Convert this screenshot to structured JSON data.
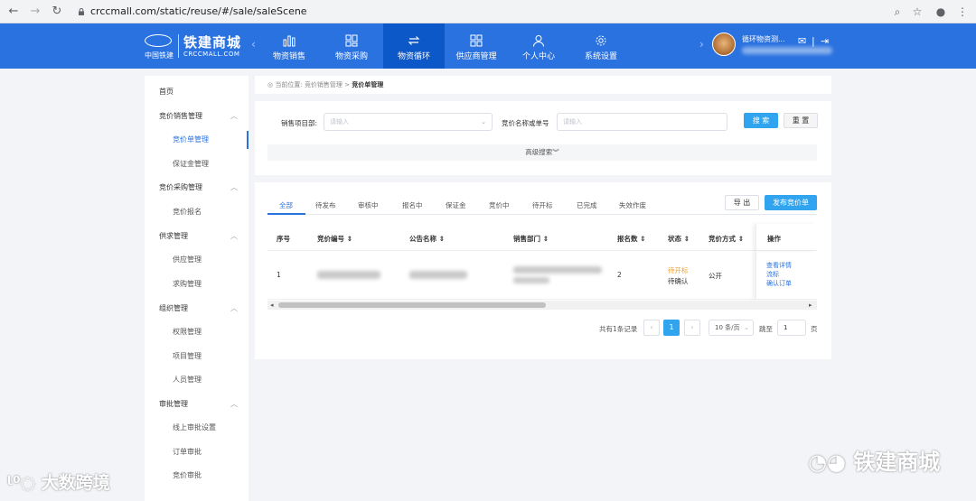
{
  "browser": {
    "url": "crccmall.com/static/reuse/#/sale/saleScene"
  },
  "header": {
    "brand": "铁建商城",
    "brand_sub": "CRCCMALL.COM",
    "org": "中国铁建",
    "nav": [
      {
        "label": "物资销售",
        "icon": "bar-chart-icon"
      },
      {
        "label": "物资采购",
        "icon": "grid-icon"
      },
      {
        "label": "物资循环",
        "icon": "recycle-icon"
      },
      {
        "label": "供应商管理",
        "icon": "apps-icon"
      },
      {
        "label": "个人中心",
        "icon": "user-icon"
      },
      {
        "label": "系统设置",
        "icon": "gear-icon"
      }
    ],
    "active_nav": "物资循环",
    "user_name": "循环物资测..."
  },
  "sidebar": {
    "items": [
      {
        "label": "首页",
        "level": "top"
      },
      {
        "label": "竞价销售管理",
        "level": "top"
      },
      {
        "label": "竞价单管理",
        "level": "sub"
      },
      {
        "label": "保证金管理",
        "level": "sub"
      },
      {
        "label": "竞价采购管理",
        "level": "top"
      },
      {
        "label": "竞价报名",
        "level": "sub"
      },
      {
        "label": "供求管理",
        "level": "top"
      },
      {
        "label": "供应管理",
        "level": "sub"
      },
      {
        "label": "求购管理",
        "level": "sub"
      },
      {
        "label": "组织管理",
        "level": "top"
      },
      {
        "label": "权限管理",
        "level": "sub"
      },
      {
        "label": "项目管理",
        "level": "sub"
      },
      {
        "label": "人员管理",
        "level": "sub"
      },
      {
        "label": "审批管理",
        "level": "top"
      },
      {
        "label": "线上审批设置",
        "level": "sub"
      },
      {
        "label": "订单审批",
        "level": "sub"
      },
      {
        "label": "竞价审批",
        "level": "sub"
      }
    ]
  },
  "breadcrumb": {
    "prefix": "当前位置:",
    "parent": "竞价销售管理",
    "sep": ">",
    "current": "竞价单管理"
  },
  "search": {
    "project_label": "销售项目部:",
    "project_placeholder": "请输入",
    "name_label": "竞价名称或单号",
    "name_placeholder": "请输入",
    "search_btn": "搜 索",
    "reset_btn": "重 置",
    "advanced": "高级搜索"
  },
  "tabs": [
    "全部",
    "待发布",
    "审核中",
    "报名中",
    "保证金",
    "竞价中",
    "待开标",
    "已完成",
    "失效作废"
  ],
  "actions": {
    "export": "导 出",
    "publish": "发布竞价单"
  },
  "table": {
    "columns": [
      "序号",
      "竞价编号",
      "公告名称",
      "销售部门",
      "报名数",
      "状态",
      "竞价方式",
      "操作"
    ],
    "row": {
      "index": "1",
      "count": "2",
      "status1": "待开标",
      "status2": "待确认",
      "method": "公开",
      "ops": [
        "查看详情",
        "流标",
        "确认订单"
      ]
    }
  },
  "pagination": {
    "total": "共有1条记录",
    "current": "1",
    "page_size": "10 条/页",
    "goto": "跳至",
    "goto_value": "1",
    "page": "页"
  },
  "watermarks": {
    "left": "大数跨境",
    "right": "铁建商城"
  },
  "colors": {
    "header": "#2a72e0",
    "active_nav": "#0d58c9",
    "primary_btn": "#31a4f0",
    "status_orange": "#f0a030"
  }
}
